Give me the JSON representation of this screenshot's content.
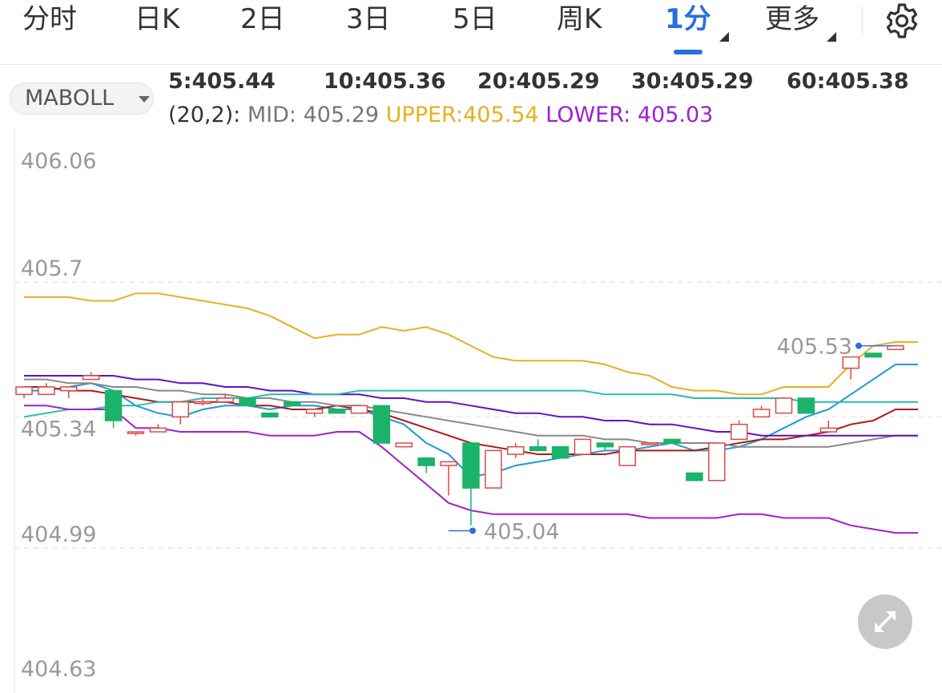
{
  "tabs": [
    {
      "label": "分时",
      "active": false,
      "menu": false
    },
    {
      "label": "日K",
      "active": false,
      "menu": false
    },
    {
      "label": "2日",
      "active": false,
      "menu": false
    },
    {
      "label": "3日",
      "active": false,
      "menu": false
    },
    {
      "label": "5日",
      "active": false,
      "menu": false
    },
    {
      "label": "周K",
      "active": false,
      "menu": false
    },
    {
      "label": "1分",
      "active": true,
      "menu": true
    },
    {
      "label": "更多",
      "active": false,
      "menu": true
    }
  ],
  "indicator": {
    "selector": "MABOLL",
    "ma": [
      {
        "text": "5:405.44",
        "color": "#4a8fe0"
      },
      {
        "text": "10:405.36",
        "color": "#e04848"
      },
      {
        "text": "20:405.29",
        "color": "#f08a2a"
      },
      {
        "text": "30:405.29",
        "color": "#1f3fbf"
      },
      {
        "text": "60:405.38",
        "color": "#2ec8b0"
      }
    ],
    "boll_params": "(20,2):",
    "boll_mid": "MID: 405.29",
    "boll_upper": "UPPER:405.54",
    "boll_lower": "LOWER: 405.03",
    "colors": {
      "mid": "#777777",
      "upper": "#e8b020",
      "lower": "#a020d0"
    }
  },
  "chart_data": {
    "type": "candlestick",
    "y_ticks": [
      "406.06",
      "405.7",
      "405.34",
      "404.99",
      "404.63"
    ],
    "ylim": [
      404.63,
      406.06
    ],
    "grid": true,
    "high_label": "405.53",
    "low_label": "405.04",
    "up_color": "#e0484a",
    "down_color": "#1bb36a",
    "candles": [
      {
        "o": 405.4,
        "c": 405.42,
        "h": 405.42,
        "l": 405.39
      },
      {
        "o": 405.4,
        "c": 405.42,
        "h": 405.43,
        "l": 405.4
      },
      {
        "o": 405.41,
        "c": 405.42,
        "h": 405.42,
        "l": 405.39
      },
      {
        "o": 405.44,
        "c": 405.45,
        "h": 405.46,
        "l": 405.44
      },
      {
        "o": 405.41,
        "c": 405.33,
        "h": 405.41,
        "l": 405.31
      },
      {
        "o": 405.3,
        "c": 405.3,
        "h": 405.3,
        "l": 405.29
      },
      {
        "o": 405.3,
        "c": 405.31,
        "h": 405.32,
        "l": 405.3
      },
      {
        "o": 405.34,
        "c": 405.38,
        "h": 405.38,
        "l": 405.32
      },
      {
        "o": 405.38,
        "c": 405.38,
        "h": 405.39,
        "l": 405.37
      },
      {
        "o": 405.38,
        "c": 405.39,
        "h": 405.4,
        "l": 405.38
      },
      {
        "o": 405.39,
        "c": 405.37,
        "h": 405.39,
        "l": 405.37
      },
      {
        "o": 405.35,
        "c": 405.34,
        "h": 405.35,
        "l": 405.34
      },
      {
        "o": 405.38,
        "c": 405.37,
        "h": 405.38,
        "l": 405.37
      },
      {
        "o": 405.35,
        "c": 405.36,
        "h": 405.36,
        "l": 405.34
      },
      {
        "o": 405.36,
        "c": 405.35,
        "h": 405.36,
        "l": 405.35
      },
      {
        "o": 405.35,
        "c": 405.37,
        "h": 405.37,
        "l": 405.35
      },
      {
        "o": 405.37,
        "c": 405.27,
        "h": 405.37,
        "l": 405.27
      },
      {
        "o": 405.26,
        "c": 405.27,
        "h": 405.27,
        "l": 405.26
      },
      {
        "o": 405.23,
        "c": 405.21,
        "h": 405.23,
        "l": 405.19
      },
      {
        "o": 405.21,
        "c": 405.22,
        "h": 405.22,
        "l": 405.13
      },
      {
        "o": 405.27,
        "c": 405.15,
        "h": 405.27,
        "l": 405.05
      },
      {
        "o": 405.15,
        "c": 405.25,
        "h": 405.25,
        "l": 405.15
      },
      {
        "o": 405.24,
        "c": 405.26,
        "h": 405.27,
        "l": 405.23
      },
      {
        "o": 405.26,
        "c": 405.25,
        "h": 405.28,
        "l": 405.25
      },
      {
        "o": 405.26,
        "c": 405.23,
        "h": 405.26,
        "l": 405.23
      },
      {
        "o": 405.24,
        "c": 405.28,
        "h": 405.28,
        "l": 405.24
      },
      {
        "o": 405.27,
        "c": 405.26,
        "h": 405.27,
        "l": 405.25
      },
      {
        "o": 405.21,
        "c": 405.26,
        "h": 405.26,
        "l": 405.21
      },
      {
        "o": 405.27,
        "c": 405.27,
        "h": 405.27,
        "l": 405.27
      },
      {
        "o": 405.28,
        "c": 405.27,
        "h": 405.28,
        "l": 405.27
      },
      {
        "o": 405.19,
        "c": 405.17,
        "h": 405.19,
        "l": 405.17
      },
      {
        "o": 405.17,
        "c": 405.27,
        "h": 405.27,
        "l": 405.17
      },
      {
        "o": 405.28,
        "c": 405.32,
        "h": 405.33,
        "l": 405.28
      },
      {
        "o": 405.34,
        "c": 405.36,
        "h": 405.37,
        "l": 405.34
      },
      {
        "o": 405.35,
        "c": 405.39,
        "h": 405.39,
        "l": 405.35
      },
      {
        "o": 405.39,
        "c": 405.35,
        "h": 405.39,
        "l": 405.35
      },
      {
        "o": 405.3,
        "c": 405.31,
        "h": 405.33,
        "l": 405.3
      },
      {
        "o": 405.47,
        "c": 405.5,
        "h": 405.5,
        "l": 405.44
      },
      {
        "o": 405.51,
        "c": 405.5,
        "h": 405.51,
        "l": 405.5
      },
      {
        "o": 405.52,
        "c": 405.53,
        "h": 405.53,
        "l": 405.52
      }
    ],
    "series": [
      {
        "key": "ma5",
        "color": "#1f9ad8",
        "values": [
          405.41,
          405.41,
          405.42,
          405.43,
          405.41,
          405.37,
          405.35,
          405.34,
          405.36,
          405.37,
          405.37,
          405.36,
          405.37,
          405.37,
          405.36,
          405.36,
          405.34,
          405.32,
          405.27,
          405.24,
          405.18,
          405.19,
          405.21,
          405.22,
          405.23,
          405.24,
          405.25,
          405.25,
          405.26,
          405.27,
          405.25,
          405.25,
          405.26,
          405.28,
          405.31,
          405.34,
          405.36,
          405.4,
          405.44,
          405.48
        ]
      },
      {
        "key": "ma10",
        "color": "#b01818",
        "values": [
          405.42,
          405.42,
          405.41,
          405.41,
          405.4,
          405.39,
          405.38,
          405.38,
          405.38,
          405.38,
          405.37,
          405.37,
          405.36,
          405.36,
          405.37,
          405.36,
          405.35,
          405.33,
          405.31,
          405.29,
          405.27,
          405.26,
          405.25,
          405.24,
          405.24,
          405.24,
          405.24,
          405.25,
          405.25,
          405.25,
          405.25,
          405.26,
          405.27,
          405.28,
          405.28,
          405.29,
          405.3,
          405.32,
          405.33,
          405.36
        ]
      },
      {
        "key": "ma20",
        "color": "#888888",
        "values": [
          405.44,
          405.44,
          405.43,
          405.43,
          405.42,
          405.42,
          405.41,
          405.41,
          405.4,
          405.4,
          405.39,
          405.39,
          405.38,
          405.38,
          405.37,
          405.37,
          405.36,
          405.35,
          405.34,
          405.33,
          405.32,
          405.31,
          405.3,
          405.29,
          405.29,
          405.29,
          405.28,
          405.28,
          405.27,
          405.27,
          405.27,
          405.27,
          405.26,
          405.26,
          405.26,
          405.26,
          405.26,
          405.27,
          405.28,
          405.29
        ]
      },
      {
        "key": "ma30",
        "color": "#6010c8",
        "values": [
          405.45,
          405.45,
          405.45,
          405.45,
          405.45,
          405.44,
          405.44,
          405.43,
          405.43,
          405.42,
          405.42,
          405.41,
          405.41,
          405.4,
          405.4,
          405.4,
          405.39,
          405.39,
          405.38,
          405.38,
          405.37,
          405.36,
          405.35,
          405.35,
          405.34,
          405.34,
          405.33,
          405.33,
          405.32,
          405.32,
          405.31,
          405.3,
          405.3,
          405.29,
          405.29,
          405.29,
          405.29,
          405.29,
          405.29,
          405.29
        ]
      },
      {
        "key": "ma60",
        "color": "#2abcaa",
        "values": [
          405.34,
          405.35,
          405.36,
          405.36,
          405.37,
          405.37,
          405.38,
          405.38,
          405.39,
          405.39,
          405.39,
          405.4,
          405.4,
          405.4,
          405.4,
          405.41,
          405.41,
          405.41,
          405.41,
          405.41,
          405.41,
          405.41,
          405.41,
          405.41,
          405.41,
          405.41,
          405.4,
          405.4,
          405.4,
          405.4,
          405.39,
          405.39,
          405.39,
          405.39,
          405.39,
          405.38,
          405.38,
          405.38,
          405.38,
          405.38
        ]
      },
      {
        "key": "upper",
        "color": "#e8b020",
        "values": [
          405.66,
          405.66,
          405.66,
          405.65,
          405.65,
          405.67,
          405.67,
          405.66,
          405.65,
          405.64,
          405.63,
          405.61,
          405.58,
          405.55,
          405.56,
          405.56,
          405.58,
          405.57,
          405.58,
          405.56,
          405.53,
          405.5,
          405.49,
          405.49,
          405.49,
          405.49,
          405.48,
          405.46,
          405.45,
          405.42,
          405.41,
          405.41,
          405.4,
          405.4,
          405.42,
          405.42,
          405.42,
          405.48,
          405.53,
          405.54
        ]
      },
      {
        "key": "lower",
        "color": "#a020d0",
        "values": [
          405.37,
          405.37,
          405.36,
          405.36,
          405.36,
          405.31,
          405.31,
          405.3,
          405.3,
          405.3,
          405.3,
          405.29,
          405.29,
          405.29,
          405.3,
          405.3,
          405.26,
          405.21,
          405.16,
          405.11,
          405.09,
          405.08,
          405.08,
          405.08,
          405.08,
          405.08,
          405.08,
          405.08,
          405.07,
          405.07,
          405.07,
          405.07,
          405.08,
          405.08,
          405.07,
          405.07,
          405.07,
          405.05,
          405.04,
          405.03
        ]
      }
    ]
  }
}
